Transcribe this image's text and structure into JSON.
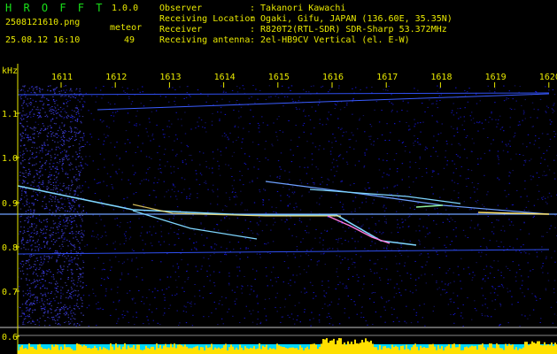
{
  "header": {
    "app_name": "H R O F F T",
    "version": "1.0.0",
    "filename": "2508121610.png",
    "datetime": "25.08.12 16:10",
    "meteor_label": "meteor",
    "meteor_count": "49",
    "info": [
      {
        "key": "Observer",
        "value": ": Takanori Kawachi"
      },
      {
        "key": "Receiving Location",
        "value": ": Ogaki, Gifu, JAPAN (136.60E, 35.35N)"
      },
      {
        "key": "Receiver",
        "value": ": R820T2(RTL-SDR) SDR-Sharp 53.372MHz"
      },
      {
        "key": "Receiving antenna",
        "value": ": 2el-HB9CV Vertical (el. E-W)"
      }
    ]
  },
  "axes": {
    "y_unit": "kHz",
    "y_ticks": [
      "1.1",
      "1.0",
      "0.9",
      "0.8",
      "0.7",
      "0.6"
    ],
    "x_ticks": [
      "1611",
      "1612",
      "1613",
      "1614",
      "1615",
      "1616",
      "1617",
      "1618",
      "1619",
      "1620"
    ]
  },
  "colors": {
    "background": "#000000",
    "noise": "#10108a",
    "text": "#e8e800",
    "app_name": "#19e019",
    "signal": "#7fd6ff",
    "level_yellow": "#ffe000",
    "level_cyan": "#00d8ff"
  }
}
